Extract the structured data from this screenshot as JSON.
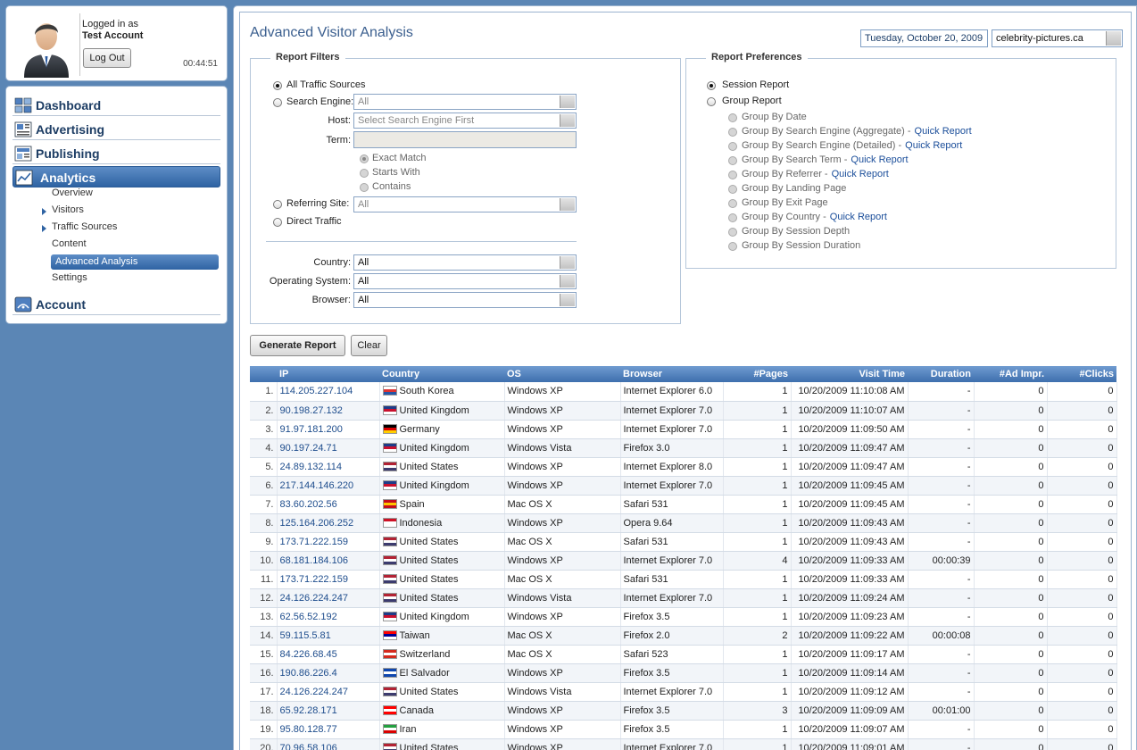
{
  "user": {
    "logged_in_label": "Logged in as",
    "account_name": "Test Account",
    "logout_label": "Log Out",
    "session_timer": "00:44:51"
  },
  "nav": {
    "main": [
      {
        "label": "Dashboard",
        "icon": "dashboard-icon"
      },
      {
        "label": "Advertising",
        "icon": "advertising-icon"
      },
      {
        "label": "Publishing",
        "icon": "publishing-icon"
      },
      {
        "label": "Analytics",
        "icon": "analytics-icon",
        "active": true
      },
      {
        "label": "Account",
        "icon": "account-icon"
      }
    ],
    "analytics_sub": [
      {
        "label": "Overview"
      },
      {
        "label": "Visitors",
        "expandable": true
      },
      {
        "label": "Traffic Sources",
        "expandable": true
      },
      {
        "label": "Content"
      },
      {
        "label": "Advanced Analysis",
        "active": true
      },
      {
        "label": "Settings"
      }
    ]
  },
  "header": {
    "title": "Advanced Visitor Analysis",
    "date": "Tuesday, October 20, 2009",
    "site": "celebrity-pictures.ca"
  },
  "filters": {
    "legend": "Report Filters",
    "all_traffic": "All Traffic Sources",
    "search_engine_label": "Search Engine:",
    "search_engine_value": "All",
    "host_label": "Host:",
    "host_value": "Select Search Engine First",
    "term_label": "Term:",
    "term_value": "",
    "match_options": [
      "Exact Match",
      "Starts With",
      "Contains"
    ],
    "referring_label": "Referring Site:",
    "referring_value": "All",
    "direct_label": "Direct Traffic",
    "country_label": "Country:",
    "country_value": "All",
    "os_label": "Operating System:",
    "os_value": "All",
    "browser_label": "Browser:",
    "browser_value": "All"
  },
  "prefs": {
    "legend": "Report Preferences",
    "session_report": "Session Report",
    "group_report": "Group Report",
    "quick_report": "Quick Report",
    "groups": [
      {
        "label": "Group By Date",
        "quick": false
      },
      {
        "label": "Group By Search Engine (Aggregate) -",
        "quick": true
      },
      {
        "label": "Group By Search Engine (Detailed) -",
        "quick": true
      },
      {
        "label": "Group By Search Term -",
        "quick": true
      },
      {
        "label": "Group By Referrer -",
        "quick": true
      },
      {
        "label": "Group By Landing Page",
        "quick": false
      },
      {
        "label": "Group By Exit Page",
        "quick": false
      },
      {
        "label": "Group By Country -",
        "quick": true
      },
      {
        "label": "Group By Session Depth",
        "quick": false
      },
      {
        "label": "Group By Session Duration",
        "quick": false
      }
    ]
  },
  "actions": {
    "generate": "Generate Report",
    "clear": "Clear"
  },
  "table": {
    "headers": [
      "IP",
      "Country",
      "OS",
      "Browser",
      "#Pages",
      "Visit Time",
      "Duration",
      "#Ad Impr.",
      "#Clicks"
    ],
    "rows": [
      [
        "1.",
        "114.205.227.104",
        "South Korea",
        "Windows XP",
        "Internet Explorer 6.0",
        "1",
        "10/20/2009 11:10:08 AM",
        "-",
        "0",
        "0"
      ],
      [
        "2.",
        "90.198.27.132",
        "United Kingdom",
        "Windows XP",
        "Internet Explorer 7.0",
        "1",
        "10/20/2009 11:10:07 AM",
        "-",
        "0",
        "0"
      ],
      [
        "3.",
        "91.97.181.200",
        "Germany",
        "Windows XP",
        "Internet Explorer 7.0",
        "1",
        "10/20/2009 11:09:50 AM",
        "-",
        "0",
        "0"
      ],
      [
        "4.",
        "90.197.24.71",
        "United Kingdom",
        "Windows Vista",
        "Firefox 3.0",
        "1",
        "10/20/2009 11:09:47 AM",
        "-",
        "0",
        "0"
      ],
      [
        "5.",
        "24.89.132.114",
        "United States",
        "Windows XP",
        "Internet Explorer 8.0",
        "1",
        "10/20/2009 11:09:47 AM",
        "-",
        "0",
        "0"
      ],
      [
        "6.",
        "217.144.146.220",
        "United Kingdom",
        "Windows XP",
        "Internet Explorer 7.0",
        "1",
        "10/20/2009 11:09:45 AM",
        "-",
        "0",
        "0"
      ],
      [
        "7.",
        "83.60.202.56",
        "Spain",
        "Mac OS X",
        "Safari 531",
        "1",
        "10/20/2009 11:09:45 AM",
        "-",
        "0",
        "0"
      ],
      [
        "8.",
        "125.164.206.252",
        "Indonesia",
        "Windows XP",
        "Opera 9.64",
        "1",
        "10/20/2009 11:09:43 AM",
        "-",
        "0",
        "0"
      ],
      [
        "9.",
        "173.71.222.159",
        "United States",
        "Mac OS X",
        "Safari 531",
        "1",
        "10/20/2009 11:09:43 AM",
        "-",
        "0",
        "0"
      ],
      [
        "10.",
        "68.181.184.106",
        "United States",
        "Windows XP",
        "Internet Explorer 7.0",
        "4",
        "10/20/2009 11:09:33 AM",
        "00:00:39",
        "0",
        "0"
      ],
      [
        "11.",
        "173.71.222.159",
        "United States",
        "Mac OS X",
        "Safari 531",
        "1",
        "10/20/2009 11:09:33 AM",
        "-",
        "0",
        "0"
      ],
      [
        "12.",
        "24.126.224.247",
        "United States",
        "Windows Vista",
        "Internet Explorer 7.0",
        "1",
        "10/20/2009 11:09:24 AM",
        "-",
        "0",
        "0"
      ],
      [
        "13.",
        "62.56.52.192",
        "United Kingdom",
        "Windows XP",
        "Firefox 3.5",
        "1",
        "10/20/2009 11:09:23 AM",
        "-",
        "0",
        "0"
      ],
      [
        "14.",
        "59.115.5.81",
        "Taiwan",
        "Mac OS X",
        "Firefox 2.0",
        "2",
        "10/20/2009 11:09:22 AM",
        "00:00:08",
        "0",
        "0"
      ],
      [
        "15.",
        "84.226.68.45",
        "Switzerland",
        "Mac OS X",
        "Safari 523",
        "1",
        "10/20/2009 11:09:17 AM",
        "-",
        "0",
        "0"
      ],
      [
        "16.",
        "190.86.226.4",
        "El Salvador",
        "Windows XP",
        "Firefox 3.5",
        "1",
        "10/20/2009 11:09:14 AM",
        "-",
        "0",
        "0"
      ],
      [
        "17.",
        "24.126.224.247",
        "United States",
        "Windows Vista",
        "Internet Explorer 7.0",
        "1",
        "10/20/2009 11:09:12 AM",
        "-",
        "0",
        "0"
      ],
      [
        "18.",
        "65.92.28.171",
        "Canada",
        "Windows XP",
        "Firefox 3.5",
        "3",
        "10/20/2009 11:09:09 AM",
        "00:01:00",
        "0",
        "0"
      ],
      [
        "19.",
        "95.80.128.77",
        "Iran",
        "Windows XP",
        "Firefox 3.5",
        "1",
        "10/20/2009 11:09:07 AM",
        "-",
        "0",
        "0"
      ],
      [
        "20.",
        "70.96.58.106",
        "United States",
        "Windows XP",
        "Internet Explorer 7.0",
        "1",
        "10/20/2009 11:09:01 AM",
        "-",
        "0",
        "0"
      ]
    ]
  },
  "flag_colors": {
    "South Korea": [
      "#ffffff",
      "#d33",
      "#2456a6"
    ],
    "United Kingdom": [
      "#1f3c88",
      "#c8102e",
      "#ffffff"
    ],
    "Germany": [
      "#000000",
      "#dd0000",
      "#ffce00"
    ],
    "United States": [
      "#b22234",
      "#ffffff",
      "#3c3b6e"
    ],
    "Spain": [
      "#c60b1e",
      "#ffc400",
      "#c60b1e"
    ],
    "Indonesia": [
      "#ce1126",
      "#ffffff",
      "#ffffff"
    ],
    "Taiwan": [
      "#fe0000",
      "#000095",
      "#ffffff"
    ],
    "Switzerland": [
      "#d52b1e",
      "#ffffff",
      "#d52b1e"
    ],
    "El Salvador": [
      "#0f47af",
      "#ffffff",
      "#0f47af"
    ],
    "Canada": [
      "#ff0000",
      "#ffffff",
      "#ff0000"
    ],
    "Iran": [
      "#239f40",
      "#ffffff",
      "#da0000"
    ]
  }
}
